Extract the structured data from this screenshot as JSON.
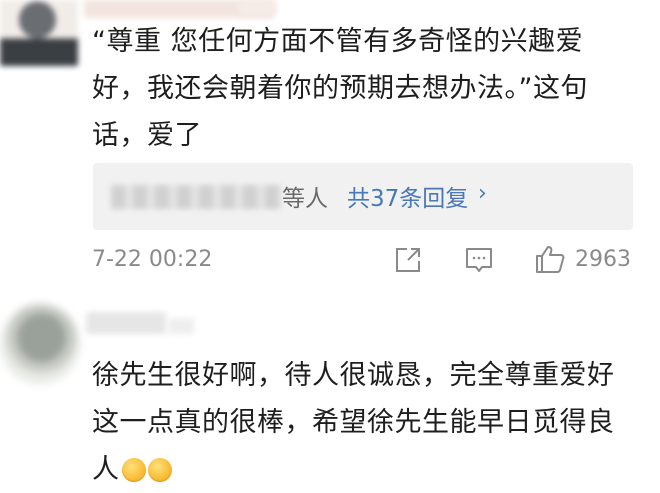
{
  "comment1": {
    "text": "“尊重 您任何方面不管有多奇怪的兴趣爱\n好，我还会朝着你的预期去想办法。”这句\n话，爱了",
    "replies": {
      "suffix": "等人",
      "link_label": "共37条回复",
      "chevron": "›"
    },
    "time": "7-22 00:22",
    "like_count": "2963"
  },
  "comment2": {
    "text": "徐先生很好啊，待人很诚恳，完全尊重爱好\n这一点真的很棒，希望徐先生能早日觅得良\n人"
  }
}
